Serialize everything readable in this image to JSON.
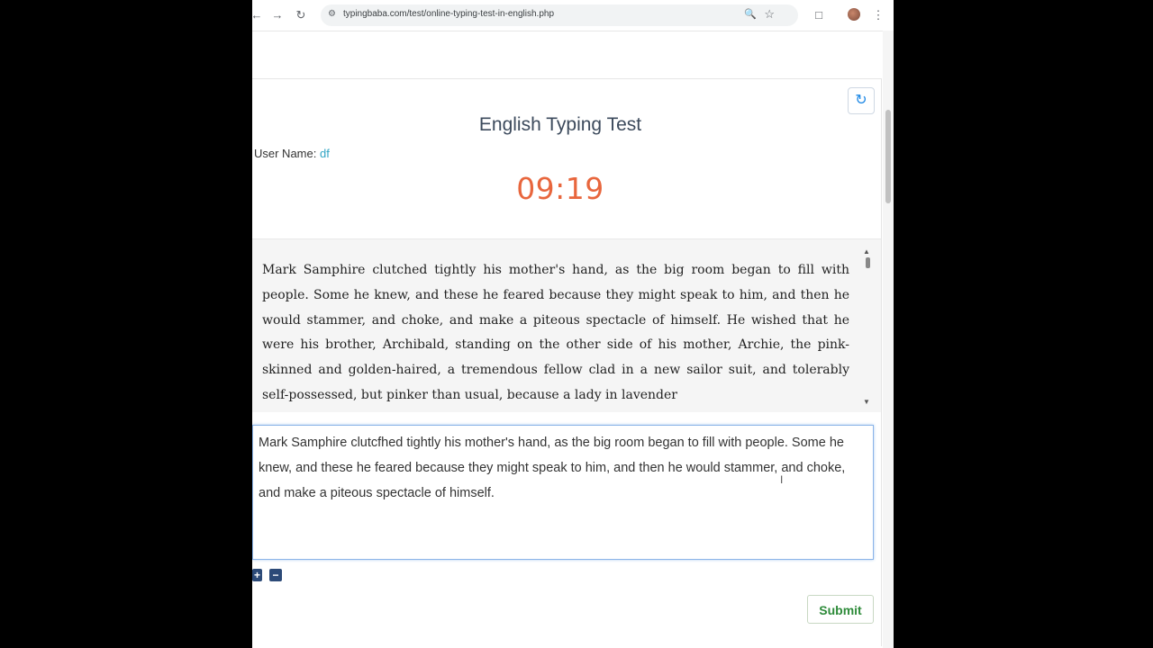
{
  "browser": {
    "url": "typingbaba.com/test/online-typing-test-in-english.php",
    "back_icon": "arrow-left-icon",
    "forward_icon": "arrow-right-icon",
    "reload_icon": "reload-icon"
  },
  "page": {
    "title": "English Typing Test",
    "user_label": "User Name:",
    "user_value": "df",
    "timer": "09:19",
    "source_text": "Mark Samphire clutched tightly his mother's hand, as the big room began to fill with people. Some he knew, and these he feared because they might speak to him, and then he would stammer, and choke, and make a piteous spectacle of himself. He wished that he were his brother, Archibald, standing on the other side of his mother, Archie, the pink-skinned and golden-haired, a tremendous fellow clad in a new sailor suit, and tolerably self-possessed, but pinker than usual, because a lady in lavender",
    "typed_text": "Mark Samphire clutcfhed tightly his mother's hand, as the big room began to fill with people. Some he knew, and these he feared because they might speak to him, and then he would stammer, and choke, and make a piteous spectacle of himself.",
    "zoom_in": "+",
    "zoom_out": "−",
    "submit_label": "Submit"
  },
  "colors": {
    "timer": "#e8663d",
    "submit_text": "#2e8b3a",
    "user_value": "#31a5c4"
  }
}
